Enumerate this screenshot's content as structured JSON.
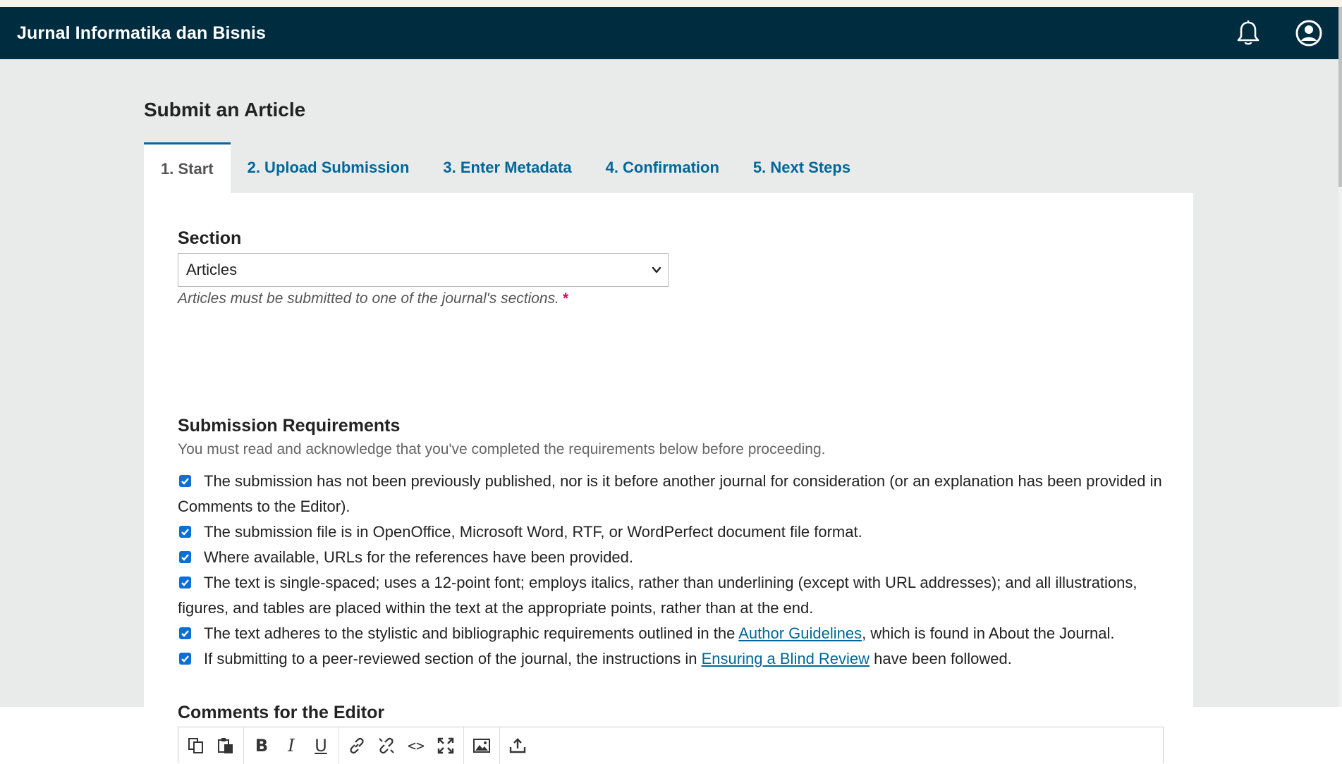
{
  "header": {
    "journal_name": "Jurnal Informatika dan Bisnis",
    "icons": [
      "bell-icon",
      "user-circle-icon"
    ],
    "bg_color": "#002c40"
  },
  "page_title": "Submit an Article",
  "tabs": [
    {
      "label": "1. Start",
      "active": true
    },
    {
      "label": "2. Upload Submission",
      "active": false
    },
    {
      "label": "3. Enter Metadata",
      "active": false
    },
    {
      "label": "4. Confirmation",
      "active": false
    },
    {
      "label": "5. Next Steps",
      "active": false
    }
  ],
  "section": {
    "label": "Section",
    "selected": "Articles",
    "help": "Articles must be submitted to one of the journal's sections.",
    "required_mark": "*"
  },
  "requirements": {
    "heading": "Submission Requirements",
    "description": "You must read and acknowledge that you've completed the requirements below before proceeding.",
    "items": [
      {
        "text": "The submission has not been previously published, nor is it before another journal for consideration (or an explanation has been provided in Comments to the Editor).",
        "checked": true
      },
      {
        "text": "The submission file is in OpenOffice, Microsoft Word, RTF, or WordPerfect document file format.",
        "checked": true
      },
      {
        "text": "Where available, URLs for the references have been provided.",
        "checked": true
      },
      {
        "text": "The text is single-spaced; uses a 12-point font; employs italics, rather than underlining (except with URL addresses); and all illustrations, figures, and tables are placed within the text at the appropriate points, rather than at the end.",
        "checked": true
      },
      {
        "text_before": "The text adheres to the stylistic and bibliographic requirements outlined in the ",
        "link": "Author Guidelines",
        "text_after": ", which is found in About the Journal.",
        "checked": true
      },
      {
        "text_before": "If submitting to a peer-reviewed section of the journal, the instructions in ",
        "link": "Ensuring a Blind Review",
        "text_after": " have been followed.",
        "checked": true
      }
    ]
  },
  "comments": {
    "label": "Comments for the Editor",
    "toolbar": {
      "bold_glyph": "B",
      "italic_glyph": "I",
      "underline_glyph": "U",
      "code_glyph": "<>",
      "icons": [
        "copy-icon",
        "paste-icon",
        "bold-icon",
        "italic-icon",
        "underline-icon",
        "link-icon",
        "unlink-icon",
        "code-icon",
        "fullscreen-icon",
        "image-icon",
        "upload-icon"
      ]
    }
  },
  "colors": {
    "accent": "#006798",
    "checkbox": "#0a6fd6",
    "required": "#d00a6c",
    "page_bg": "#e9ebeb"
  }
}
